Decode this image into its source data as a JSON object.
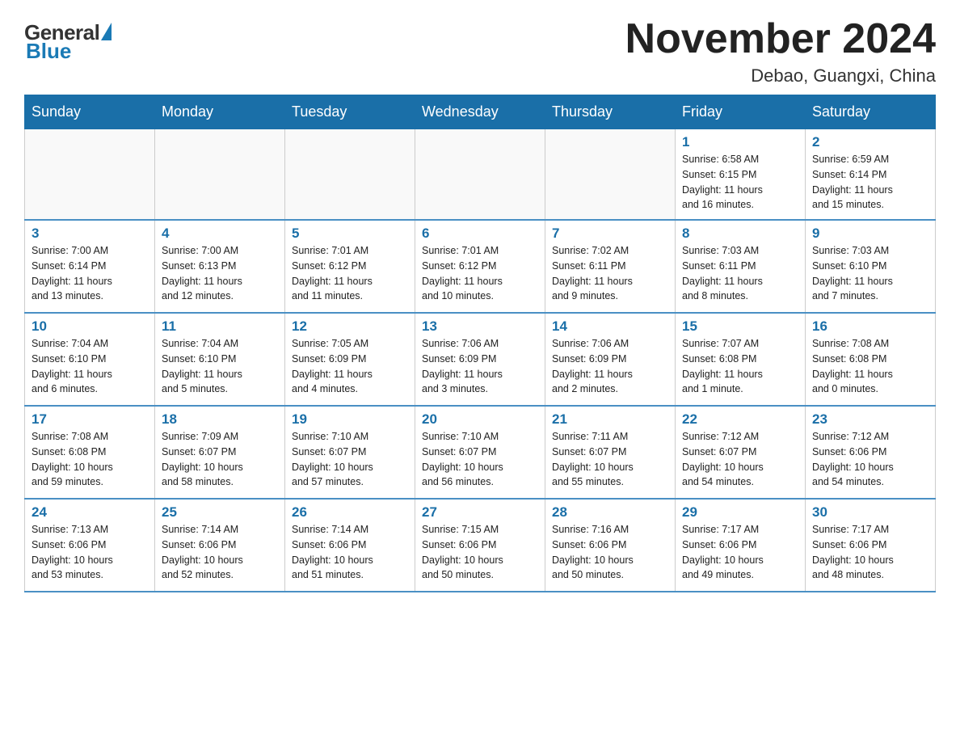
{
  "logo": {
    "general": "General",
    "blue": "Blue"
  },
  "title": "November 2024",
  "location": "Debao, Guangxi, China",
  "weekdays": [
    "Sunday",
    "Monday",
    "Tuesday",
    "Wednesday",
    "Thursday",
    "Friday",
    "Saturday"
  ],
  "weeks": [
    [
      {
        "day": "",
        "info": ""
      },
      {
        "day": "",
        "info": ""
      },
      {
        "day": "",
        "info": ""
      },
      {
        "day": "",
        "info": ""
      },
      {
        "day": "",
        "info": ""
      },
      {
        "day": "1",
        "info": "Sunrise: 6:58 AM\nSunset: 6:15 PM\nDaylight: 11 hours\nand 16 minutes."
      },
      {
        "day": "2",
        "info": "Sunrise: 6:59 AM\nSunset: 6:14 PM\nDaylight: 11 hours\nand 15 minutes."
      }
    ],
    [
      {
        "day": "3",
        "info": "Sunrise: 7:00 AM\nSunset: 6:14 PM\nDaylight: 11 hours\nand 13 minutes."
      },
      {
        "day": "4",
        "info": "Sunrise: 7:00 AM\nSunset: 6:13 PM\nDaylight: 11 hours\nand 12 minutes."
      },
      {
        "day": "5",
        "info": "Sunrise: 7:01 AM\nSunset: 6:12 PM\nDaylight: 11 hours\nand 11 minutes."
      },
      {
        "day": "6",
        "info": "Sunrise: 7:01 AM\nSunset: 6:12 PM\nDaylight: 11 hours\nand 10 minutes."
      },
      {
        "day": "7",
        "info": "Sunrise: 7:02 AM\nSunset: 6:11 PM\nDaylight: 11 hours\nand 9 minutes."
      },
      {
        "day": "8",
        "info": "Sunrise: 7:03 AM\nSunset: 6:11 PM\nDaylight: 11 hours\nand 8 minutes."
      },
      {
        "day": "9",
        "info": "Sunrise: 7:03 AM\nSunset: 6:10 PM\nDaylight: 11 hours\nand 7 minutes."
      }
    ],
    [
      {
        "day": "10",
        "info": "Sunrise: 7:04 AM\nSunset: 6:10 PM\nDaylight: 11 hours\nand 6 minutes."
      },
      {
        "day": "11",
        "info": "Sunrise: 7:04 AM\nSunset: 6:10 PM\nDaylight: 11 hours\nand 5 minutes."
      },
      {
        "day": "12",
        "info": "Sunrise: 7:05 AM\nSunset: 6:09 PM\nDaylight: 11 hours\nand 4 minutes."
      },
      {
        "day": "13",
        "info": "Sunrise: 7:06 AM\nSunset: 6:09 PM\nDaylight: 11 hours\nand 3 minutes."
      },
      {
        "day": "14",
        "info": "Sunrise: 7:06 AM\nSunset: 6:09 PM\nDaylight: 11 hours\nand 2 minutes."
      },
      {
        "day": "15",
        "info": "Sunrise: 7:07 AM\nSunset: 6:08 PM\nDaylight: 11 hours\nand 1 minute."
      },
      {
        "day": "16",
        "info": "Sunrise: 7:08 AM\nSunset: 6:08 PM\nDaylight: 11 hours\nand 0 minutes."
      }
    ],
    [
      {
        "day": "17",
        "info": "Sunrise: 7:08 AM\nSunset: 6:08 PM\nDaylight: 10 hours\nand 59 minutes."
      },
      {
        "day": "18",
        "info": "Sunrise: 7:09 AM\nSunset: 6:07 PM\nDaylight: 10 hours\nand 58 minutes."
      },
      {
        "day": "19",
        "info": "Sunrise: 7:10 AM\nSunset: 6:07 PM\nDaylight: 10 hours\nand 57 minutes."
      },
      {
        "day": "20",
        "info": "Sunrise: 7:10 AM\nSunset: 6:07 PM\nDaylight: 10 hours\nand 56 minutes."
      },
      {
        "day": "21",
        "info": "Sunrise: 7:11 AM\nSunset: 6:07 PM\nDaylight: 10 hours\nand 55 minutes."
      },
      {
        "day": "22",
        "info": "Sunrise: 7:12 AM\nSunset: 6:07 PM\nDaylight: 10 hours\nand 54 minutes."
      },
      {
        "day": "23",
        "info": "Sunrise: 7:12 AM\nSunset: 6:06 PM\nDaylight: 10 hours\nand 54 minutes."
      }
    ],
    [
      {
        "day": "24",
        "info": "Sunrise: 7:13 AM\nSunset: 6:06 PM\nDaylight: 10 hours\nand 53 minutes."
      },
      {
        "day": "25",
        "info": "Sunrise: 7:14 AM\nSunset: 6:06 PM\nDaylight: 10 hours\nand 52 minutes."
      },
      {
        "day": "26",
        "info": "Sunrise: 7:14 AM\nSunset: 6:06 PM\nDaylight: 10 hours\nand 51 minutes."
      },
      {
        "day": "27",
        "info": "Sunrise: 7:15 AM\nSunset: 6:06 PM\nDaylight: 10 hours\nand 50 minutes."
      },
      {
        "day": "28",
        "info": "Sunrise: 7:16 AM\nSunset: 6:06 PM\nDaylight: 10 hours\nand 50 minutes."
      },
      {
        "day": "29",
        "info": "Sunrise: 7:17 AM\nSunset: 6:06 PM\nDaylight: 10 hours\nand 49 minutes."
      },
      {
        "day": "30",
        "info": "Sunrise: 7:17 AM\nSunset: 6:06 PM\nDaylight: 10 hours\nand 48 minutes."
      }
    ]
  ]
}
